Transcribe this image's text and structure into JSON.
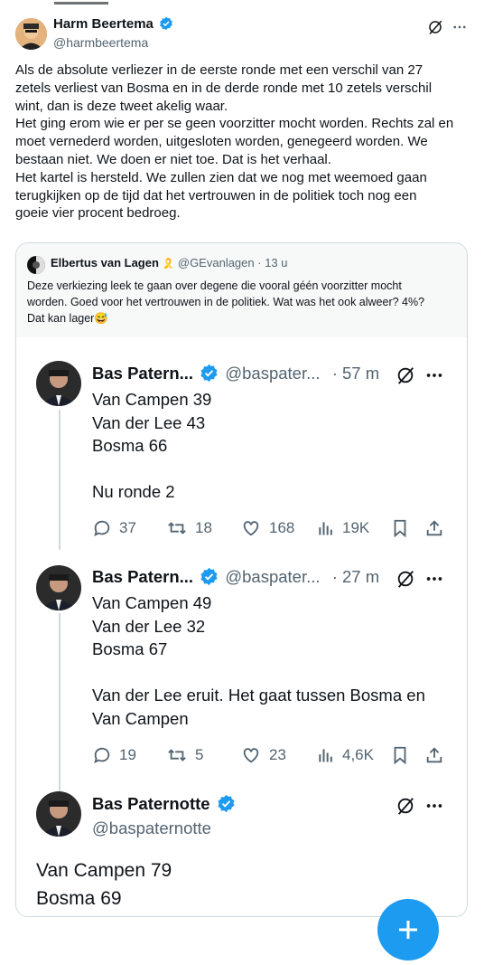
{
  "main_tweet": {
    "author_name": "Harm Beertema",
    "handle": "@harmbeertema",
    "paragraphs": [
      "Als de absolute verliezer in de eerste ronde met een verschil van 27",
      "zetels verliest van Bosma en in de derde ronde met 10 zetels verschil",
      "wint, dan is deze tweet akelig waar.",
      "Het ging erom wie er per se geen voorzitter mocht worden. Rechts zal en",
      "moet vernederd worden, uitgesloten worden, genegeerd worden. We",
      "bestaan niet. We doen er niet toe. Dat is het verhaal.",
      "Het kartel is hersteld. We zullen zien dat we nog met weemoed gaan",
      "terugkijken op de tijd dat het vertrouwen in de politiek toch nog een",
      "goeie vier procent bedroeg."
    ]
  },
  "quoted_tweet": {
    "author_name": "Elbertus van Lagen",
    "ribbon": "🎗️",
    "handle": "@GEvanlagen",
    "time": "· 13 u",
    "lines": [
      "Deze verkiezing leek te gaan over degene die vooral géén voorzitter mocht",
      "worden. Goed voor het vertrouwen in de politiek. Wat was het ook alweer? 4%?",
      "Dat kan lager😅"
    ]
  },
  "thread": [
    {
      "author_name": "Bas Patern...",
      "handle": "@baspater...",
      "time": "· 57 m",
      "lines": [
        "Van Campen 39",
        "Van der Lee 43",
        "Bosma 66",
        "",
        "Nu ronde 2"
      ],
      "replies": "37",
      "reposts": "18",
      "likes": "168",
      "views": "19K"
    },
    {
      "author_name": "Bas Patern...",
      "handle": "@baspater...",
      "time": "· 27 m",
      "lines": [
        "Van Campen 49",
        "Van der Lee 32",
        "Bosma 67",
        "",
        "Van der Lee eruit. Het gaat tussen Bosma en",
        "Van Campen"
      ],
      "replies": "19",
      "reposts": "5",
      "likes": "23",
      "views": "4,6K"
    },
    {
      "author_name": "Bas Paternotte",
      "handle": "@baspaternotte",
      "lines": [
        "Van Campen 79",
        "Bosma 69"
      ]
    }
  ],
  "colors": {
    "accent": "#1d9bf0",
    "verified": "#1d9bf0",
    "text": "#0f1419",
    "muted": "#536471",
    "border": "#cfd9de",
    "quote_bg": "#f7f9f9"
  },
  "icons": [
    "grok-icon",
    "more-icon",
    "reply-icon",
    "repost-icon",
    "like-icon",
    "views-icon",
    "bookmark-icon",
    "share-icon",
    "verified-icon",
    "compose-icon"
  ]
}
